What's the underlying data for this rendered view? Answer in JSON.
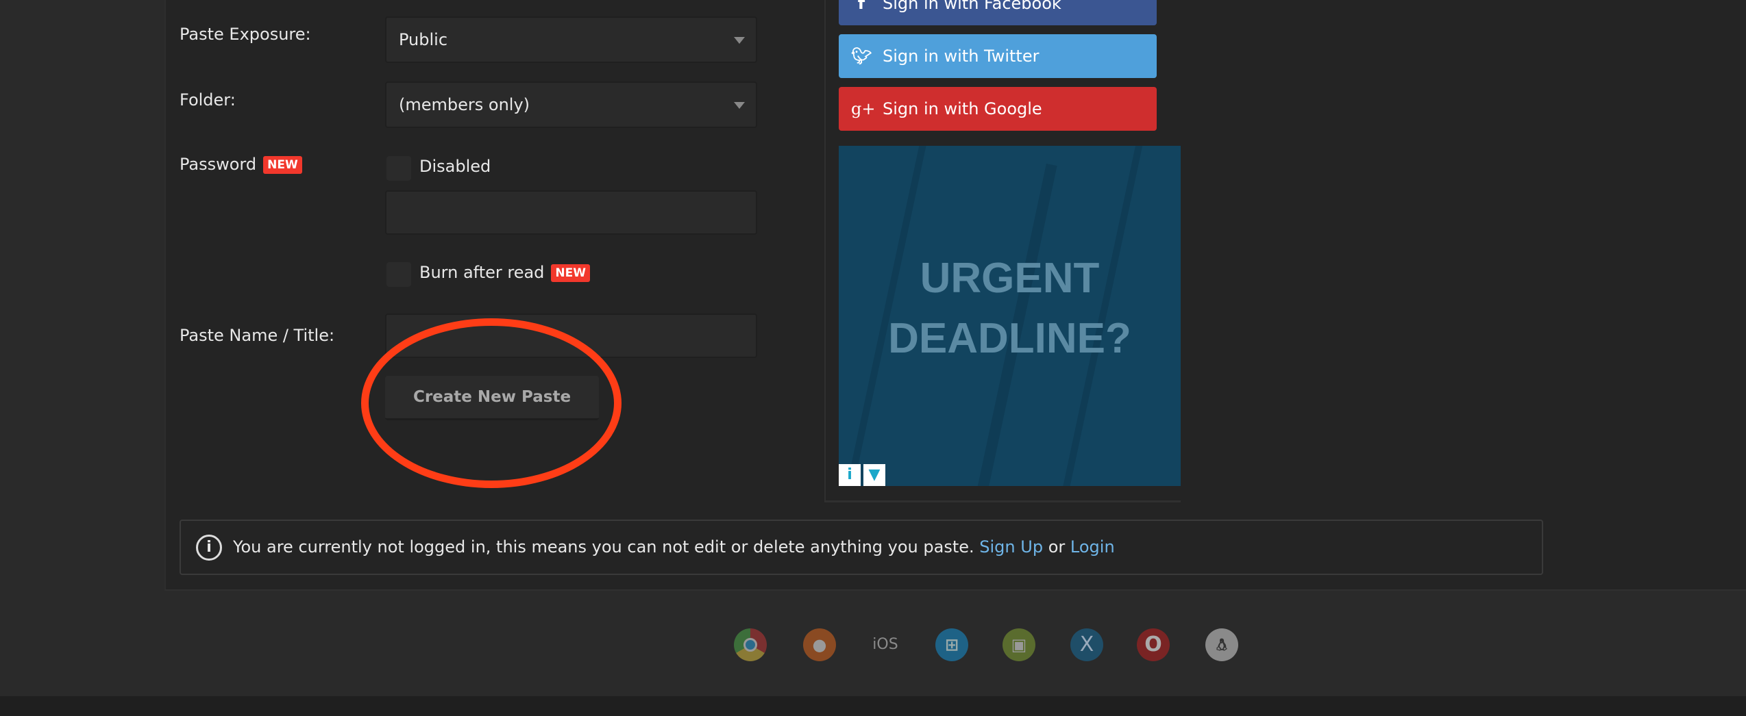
{
  "form": {
    "exposure_label": "Paste Exposure:",
    "exposure_value": "Public",
    "folder_label": "Folder:",
    "folder_value": "(members only)",
    "password_label": "Password",
    "new_badge": "NEW",
    "password_toggle_label": "Disabled",
    "password_value": "",
    "burn_label": "Burn after read",
    "title_label": "Paste Name / Title:",
    "title_value": "",
    "submit_label": "Create New Paste"
  },
  "social": {
    "facebook": {
      "label": "Sign in with Facebook",
      "color": "#3b5692"
    },
    "twitter": {
      "label": "Sign in with Twitter",
      "color": "#4fa0db"
    },
    "google": {
      "label": "Sign in with Google",
      "color": "#cf2e2e"
    }
  },
  "ad": {
    "line1": "URGENT",
    "line2": "DEADLINE?"
  },
  "notice": {
    "text": "You are currently not logged in, this means you can not edit or delete anything you paste.",
    "signup": "Sign Up",
    "or": "or",
    "login": "Login",
    "link_color": "#6fb5e8"
  },
  "footer": {
    "icons": [
      "chrome-icon",
      "firefox-icon",
      "ios-icon",
      "windows-icon",
      "android-icon",
      "macos-icon",
      "opera-icon",
      "linux-icon"
    ],
    "ios_label": "iOS"
  },
  "annotation_color": "#ff3d16"
}
